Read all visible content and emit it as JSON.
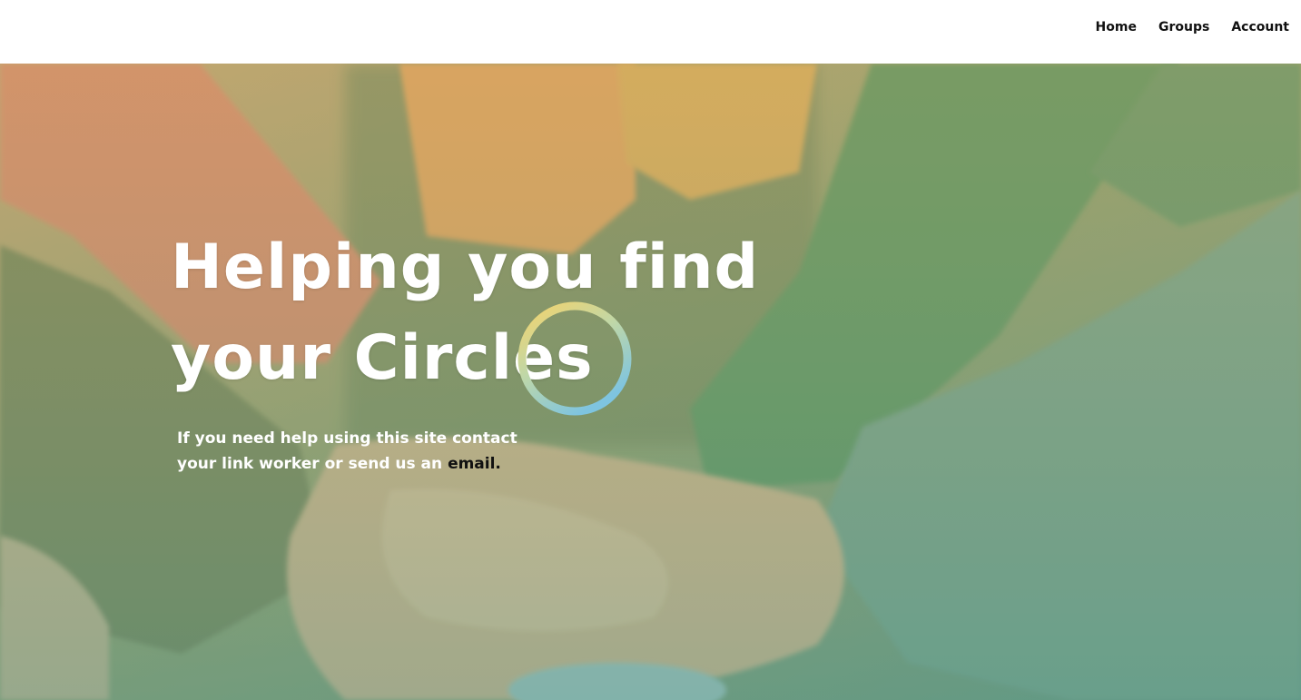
{
  "nav": {
    "items": [
      {
        "label": "Home"
      },
      {
        "label": "Groups"
      },
      {
        "label": "Account"
      }
    ]
  },
  "hero": {
    "headline_line1": "Helping you find",
    "headline_line2": "your Circles",
    "help_text": "If you need help using this site contact your link worker or send us an",
    "email_link": "email."
  },
  "colors": {
    "nav_text": "#111111",
    "headline_text": "#ffffff",
    "email_link": "#111111",
    "logo_ring_gradient": [
      "#f5d36a",
      "#9fd3d8",
      "#7ec4e0"
    ]
  }
}
